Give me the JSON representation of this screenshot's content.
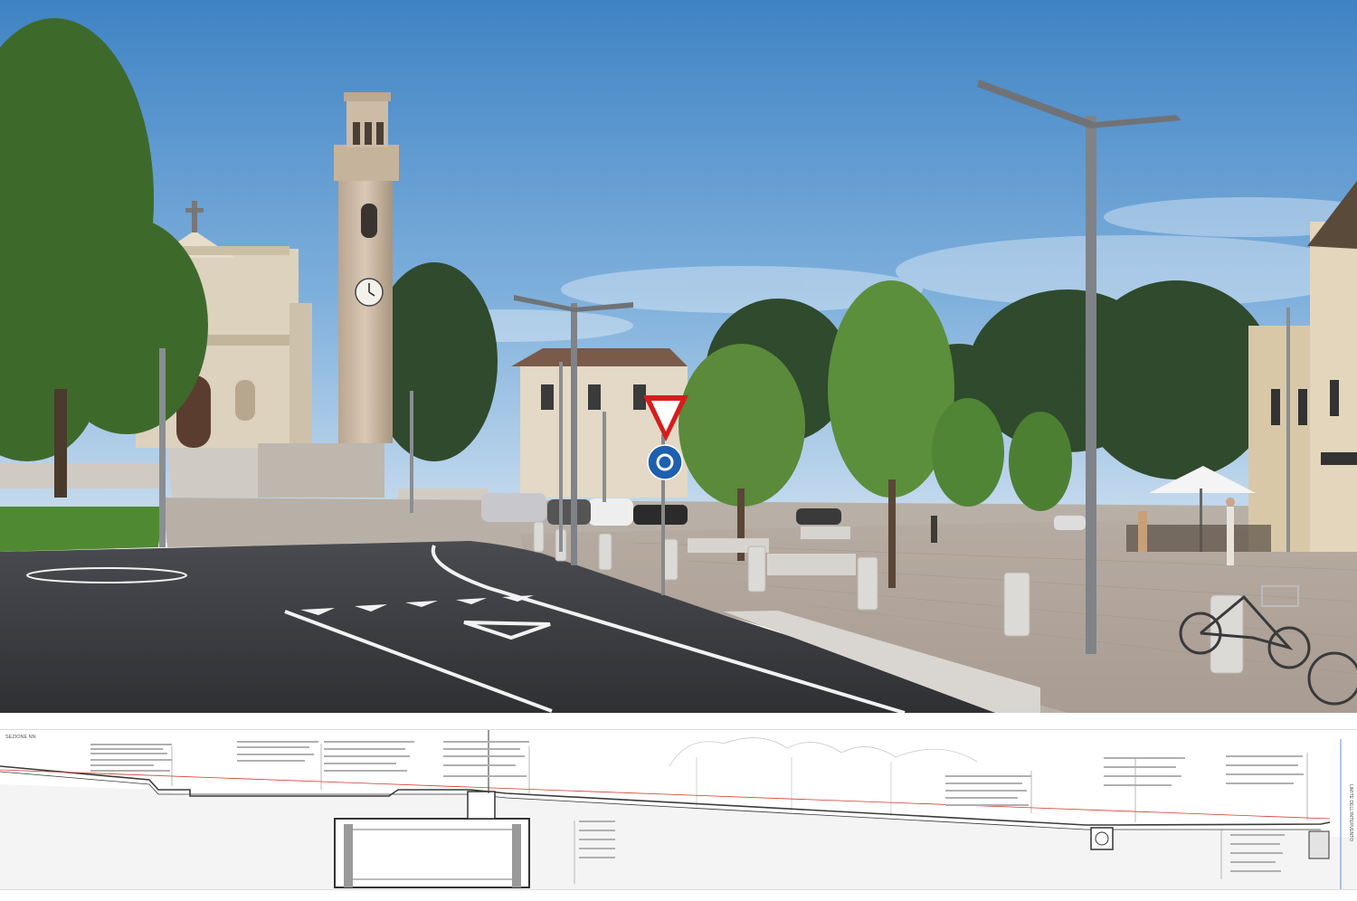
{
  "section_title": "SEZIONE NN",
  "section_limit_label": "LIMITE DELL'INTERVENTO",
  "colors": {
    "sky_top": "#3f83c4",
    "sky_bottom": "#c8dcef",
    "asphalt": "#3a3b3f",
    "paving": "#b9aea6",
    "foliage": "#3e6b2c",
    "tower": "#c9b7a3",
    "drawing_line": "#3a3a3a",
    "drawing_red": "#d23a2a"
  },
  "photo_description_icons": [
    "church-icon",
    "bell-tower-icon",
    "street-lamp-icon",
    "yield-sign-icon",
    "roundabout-sign-icon",
    "bollard-icon",
    "bicycle-icon",
    "umbrella-icon",
    "tree-icon"
  ]
}
